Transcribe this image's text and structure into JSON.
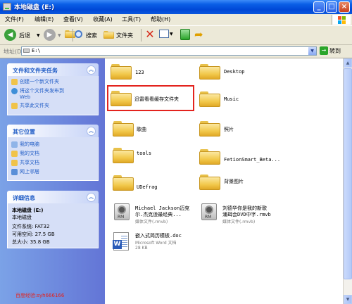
{
  "window": {
    "title": "本地磁盘 (E:)"
  },
  "menu": [
    "文件(F)",
    "编辑(E)",
    "查看(V)",
    "收藏(A)",
    "工具(T)",
    "帮助(H)"
  ],
  "toolbar": {
    "back": "后退",
    "search": "搜索",
    "folders": "文件夹"
  },
  "address": {
    "label": "地址(D)",
    "value": "E:\\",
    "go": "转到"
  },
  "tasks_panel": {
    "title": "文件和文件夹任务",
    "items": [
      "创建一个新文件夹",
      "将这个文件夹发布到",
      "Web",
      "共享此文件夹"
    ]
  },
  "places_panel": {
    "title": "其它位置",
    "items": [
      "我的电脑",
      "我的文档",
      "共享文档",
      "网上邻居"
    ]
  },
  "details_panel": {
    "title": "详细信息",
    "name": "本地磁盘 (E:)",
    "type": "本地磁盘",
    "filesystem": "文件系统: FAT32",
    "free": "可用空间: 27.5 GB",
    "total": "总大小: 35.8 GB"
  },
  "files": {
    "f1": "123",
    "f2": "Desktop",
    "f3": "迅雷看看缓存文件夹",
    "f4": "Music",
    "f5": "歌曲",
    "f6": "照片",
    "f7": "tools",
    "f8": "FetionSmart_Beta...",
    "f9": "UDefrag",
    "f10": "背景图片",
    "rm1_name": "Michael Jackson迈克",
    "rm1_name2": "尔.杰克逊最经典...",
    "rm1_type": "媒体文件(.rmvb)",
    "rm2_name": "刘德华你是我的新歌",
    "rm2_name2": "涌珥会DVD中字.rmvb",
    "rm2_type": "媒体文件(.rmvb)",
    "doc_name": "嵌入式简历模板.doc",
    "doc_type": "Microsoft Word 文档",
    "doc_size": "28 KB"
  },
  "watermark": "百度经验:syh666166",
  "colors": {
    "titlebar": "#0a5ee6",
    "taskpane": "#7ba2e7",
    "highlight": "#e3231e"
  }
}
